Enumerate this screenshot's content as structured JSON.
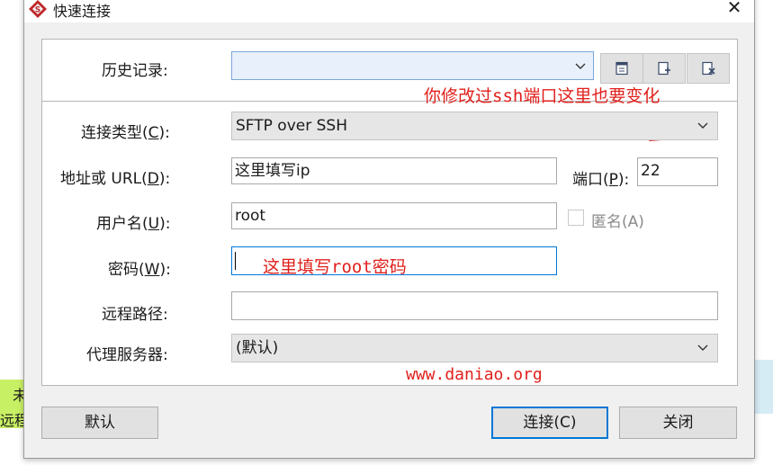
{
  "background": {
    "line1": "未",
    "line2": "远程"
  },
  "window": {
    "title": "快速连接",
    "close": "✕"
  },
  "history": {
    "label": "历史记录:",
    "value": ""
  },
  "annotations": {
    "ssh_port_note_pre": "你修改过",
    "ssh_port_note_mono": "ssh",
    "ssh_port_note_post": "端口这里也要变化",
    "password_note_pre": "这里填写",
    "password_note_mono": "root",
    "password_note_post": "密码",
    "watermark": "www.daniao.org"
  },
  "form": {
    "conn_type_label_pre": "连接类型(",
    "conn_type_label_key": "C",
    "conn_type_label_post": "):",
    "conn_type_value": "SFTP over SSH",
    "address_label_pre": "地址或 URL(",
    "address_label_key": "D",
    "address_label_post": "):",
    "address_value": "这里填写ip",
    "port_label_pre": "端口(",
    "port_label_key": "P",
    "port_label_post": "):",
    "port_value": "22",
    "user_label_pre": "用户名(",
    "user_label_key": "U",
    "user_label_post": "):",
    "user_value": "root",
    "anonymous_label": "匿名(A)",
    "password_label_pre": "密码(",
    "password_label_key": "W",
    "password_label_post": "):",
    "password_value": "",
    "remote_path_label": "远程路径:",
    "remote_path_value": "",
    "proxy_label": "代理服务器:",
    "proxy_value": "(默认)"
  },
  "buttons": {
    "default": "默认",
    "connect": "连接(C)",
    "close": "关闭"
  },
  "colors": {
    "annotation": "#e0201c",
    "default_button_border": "#0078d7",
    "history_field_bg": "#e8f0fb",
    "history_field_border": "#7aa7d9"
  }
}
